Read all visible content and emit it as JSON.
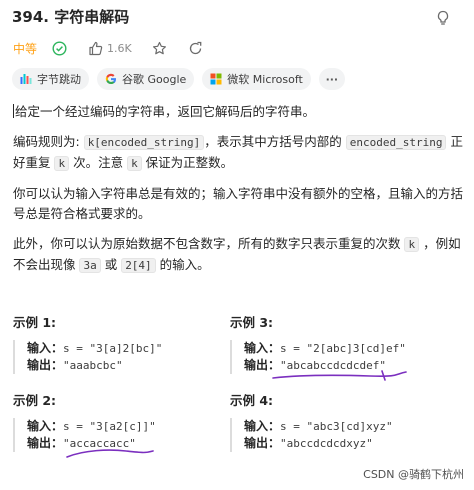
{
  "problem": {
    "title": "394. 字符串解码",
    "difficulty": "中等",
    "likes": "1.6K"
  },
  "companies": [
    {
      "name": "字节跳动",
      "icon": "bytedance-icon"
    },
    {
      "name": "谷歌 Google",
      "icon": "google-icon"
    },
    {
      "name": "微软 Microsoft",
      "icon": "microsoft-icon"
    }
  ],
  "more_label": "···",
  "description": {
    "p1": "给定一个经过编码的字符串，返回它解码后的字符串。",
    "p2_a": "编码规则为: ",
    "p2_code1": "k[encoded_string]",
    "p2_b": "，表示其中方括号内部的 ",
    "p2_code2": "encoded_string",
    "p2_c": " 正好重复 ",
    "p2_code3": "k",
    "p2_d": " 次。注意 ",
    "p2_code4": "k",
    "p2_e": " 保证为正整数。",
    "p3": "你可以认为输入字符串总是有效的；输入字符串中没有额外的空格，且输入的方括号总是符合格式要求的。",
    "p4_a": "此外，你可以认为原始数据不包含数字，所有的数字只表示重复的次数 ",
    "p4_code1": "k",
    "p4_b": " ，例如不会出现像 ",
    "p4_code2": "3a",
    "p4_c": " 或 ",
    "p4_code3": "2[4]",
    "p4_d": " 的输入。"
  },
  "examples": [
    {
      "title": "示例 1:",
      "input_label": "输入：",
      "input": "s = \"3[a]2[bc]\"",
      "output_label": "输出：",
      "output": "\"aaabcbc\""
    },
    {
      "title": "示例 2:",
      "input_label": "输入：",
      "input": "s = \"3[a2[c]]\"",
      "output_label": "输出：",
      "output": "\"accaccacc\""
    },
    {
      "title": "示例 3:",
      "input_label": "输入：",
      "input": "s = \"2[abc]3[cd]ef\"",
      "output_label": "输出：",
      "output": "\"abcabccdcdcdef\""
    },
    {
      "title": "示例 4:",
      "input_label": "输入：",
      "input": "s = \"abc3[cd]xyz\"",
      "output_label": "输出：",
      "output": "\"abccdcdcdxyz\""
    }
  ],
  "watermark": "CSDN @骑鹤下杭州",
  "colors": {
    "difficulty": "#ffa116",
    "solved_check": "#2db55d",
    "annotation": "#7b2fbf"
  }
}
